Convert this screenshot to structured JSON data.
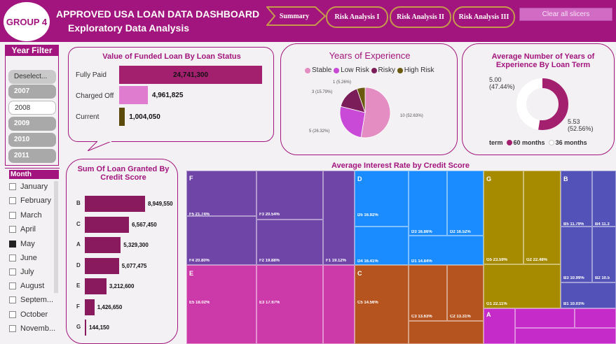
{
  "header": {
    "logo_text": "GROUP 4",
    "title": "APPROVED USA LOAN DATA DASHBOARD",
    "subtitle": "Exploratory Data Analysis",
    "nav": [
      "Summary",
      "Risk Analysis I",
      "Risk Analysis II",
      "Risk Analysis III"
    ],
    "clear_label": "Clear all slicers",
    "brand_color": "#a3157e"
  },
  "year_filter": {
    "title": "Year Filter",
    "items": [
      "Deselect...",
      "2007",
      "2008",
      "2009",
      "2010",
      "2011"
    ],
    "selected": "2008"
  },
  "month_filter": {
    "title": "Month",
    "items": [
      "January",
      "February",
      "March",
      "April",
      "May",
      "June",
      "July",
      "August",
      "Septem...",
      "October",
      "Novemb..."
    ],
    "checked": [
      "May"
    ]
  },
  "funded_by_status": {
    "title": "Value of Funded Loan By Loan Status",
    "rows": [
      {
        "label": "Fully Paid",
        "value_label": "24,741,300",
        "value": 24741300,
        "color": "#a3206e"
      },
      {
        "label": "Charged Off",
        "value_label": "4,961,825",
        "value": 4961825,
        "color": "#e07ccf"
      },
      {
        "label": "Current",
        "value_label": "1,004,050",
        "value": 1004050,
        "color": "#5c4a0b"
      }
    ]
  },
  "experience": {
    "title": "Years of Experience",
    "legend": [
      {
        "name": "Stable",
        "color": "#e48dc3"
      },
      {
        "name": "Low Risk",
        "color": "#c84ad6"
      },
      {
        "name": "Risky",
        "color": "#7b1d59"
      },
      {
        "name": "High Risk",
        "color": "#6a5a0d"
      }
    ],
    "slices": [
      {
        "name": "Stable",
        "value": 10,
        "label": "10 (52.63%)"
      },
      {
        "name": "Low Risk",
        "value": 5,
        "label": "5 (26.32%)"
      },
      {
        "name": "Risky",
        "value": 3,
        "label": "3 (15.79%)"
      },
      {
        "name": "High Risk",
        "value": 1,
        "label": "1 (5.26%)"
      }
    ]
  },
  "avg_years_term": {
    "title": "Average Number of Years of Experience By Loan Term",
    "label_36": "5.00\n(47.44%)",
    "label_36_a": "5.00",
    "label_36_b": "(47.44%)",
    "label_60_a": "5.53",
    "label_60_b": "(52.56%)",
    "legend_term": "term",
    "legend_60": "60 months",
    "legend_36": "36 months",
    "values": {
      "60 months": 5.53,
      "36 months": 5.0
    },
    "color_60": "#a3206e",
    "color_36": "#ffffff"
  },
  "loan_by_grade": {
    "title": "Sum Of Loan Granted By Credit Score",
    "rows": [
      {
        "grade": "B",
        "value": 8949550,
        "value_label": "8,949,550"
      },
      {
        "grade": "C",
        "value": 6567450,
        "value_label": "6,567,450"
      },
      {
        "grade": "A",
        "value": 5329300,
        "value_label": "5,329,300"
      },
      {
        "grade": "D",
        "value": 5077475,
        "value_label": "5,077,475"
      },
      {
        "grade": "E",
        "value": 3212600,
        "value_label": "3,212,600"
      },
      {
        "grade": "F",
        "value": 1426650,
        "value_label": "1,426,650"
      },
      {
        "grade": "G",
        "value": 144150,
        "value_label": "144,150"
      }
    ],
    "bar_color": "#8a1a5e"
  },
  "treemap": {
    "title": "Average Interest Rate by Credit Score",
    "groups": {
      "F": "F",
      "D": "D",
      "G": "G",
      "B": "B",
      "E": "E",
      "C": "C",
      "A": "A"
    },
    "cells": {
      "F5": "F5 21.74%",
      "F3": "F3 20.54%",
      "F4": "F4 20.80%",
      "F2": "F2 19.88%",
      "F1": "F1 19.12%",
      "D5": "D5 16.92%",
      "D3": "D3 16.86%",
      "D2": "D2 16.52%",
      "D4": "D4 16.41%",
      "D1": "D1 14.84%",
      "G5": "G5 23.59%",
      "G2": "G2 22.48%",
      "G1": "G1 22.11%",
      "B5": "B5 11.79%",
      "B4": "B4 11.3",
      "B3": "B3 10.99%",
      "B2": "B2 10.5",
      "B1": "B1 10.03%",
      "E5": "E5 18.02%",
      "E3": "E3 17.67%",
      "C5": "C5 14.56%",
      "C3": "C3 13.63%",
      "C2": "C2 13.31%"
    },
    "colors": {
      "F": "#6f46a8",
      "D": "#1a8cff",
      "G": "#a68a00",
      "B": "#5252b8",
      "E": "#cc3aaa",
      "C": "#b5541f",
      "A": "#c42bc9"
    }
  }
}
